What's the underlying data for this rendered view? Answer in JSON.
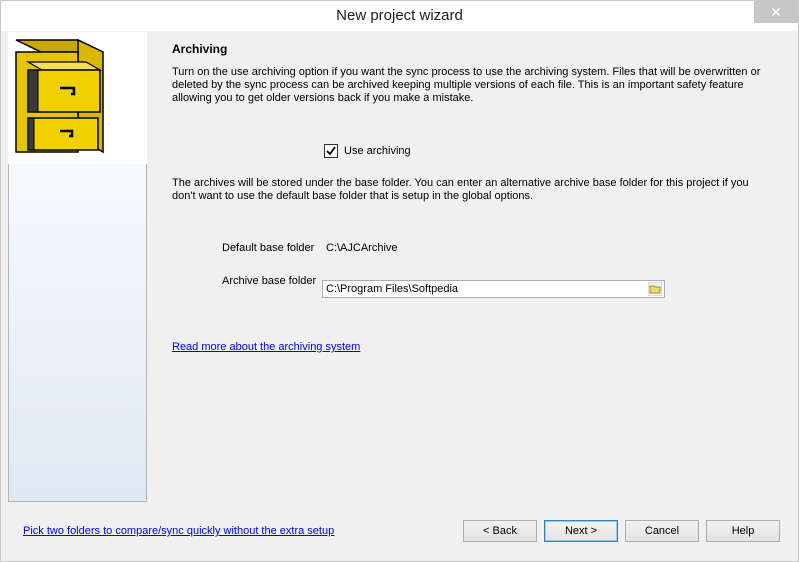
{
  "window": {
    "title": "New project wizard",
    "close_glyph": "✕"
  },
  "section": {
    "heading": "Archiving",
    "intro": "Turn on the use archiving option if you want the sync process to use the archiving system.  Files that will be overwritten or deleted by the sync process can be archived keeping multiple versions of each file.  This is an important safety feature allowing you to get older versions back if you make a mistake.",
    "use_archiving_label": "Use archiving",
    "use_archiving_checked": true,
    "base_folder_info": "The archives will be stored under the base folder.  You can enter an alternative archive base folder for this project if you don't want to use the default base folder that is setup in the global options."
  },
  "fields": {
    "default_base_folder_label": "Default base folder",
    "default_base_folder_value": "C:\\AJCArchive",
    "archive_base_folder_label": "Archive base folder",
    "archive_base_folder_value": "C:\\Program Files\\Softpedia"
  },
  "links": {
    "read_more": "Read more about the archiving system",
    "quick_compare": "Pick two folders to compare/sync quickly without the extra setup"
  },
  "buttons": {
    "back": "< Back",
    "next": "Next >",
    "cancel": "Cancel",
    "help": "Help"
  },
  "icons": {
    "logo": "filing-cabinet-icon",
    "browse": "folder-icon",
    "check": "checkmark-icon"
  },
  "colors": {
    "link": "#0000ee",
    "cabinet_yellow": "#f2d000"
  }
}
